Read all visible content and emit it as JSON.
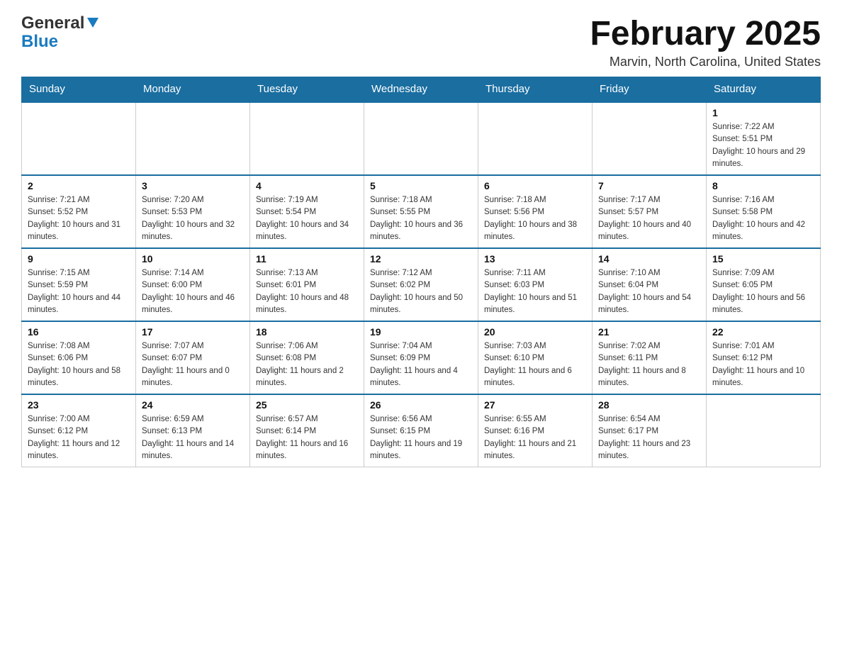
{
  "header": {
    "logo_general": "General",
    "logo_blue": "Blue",
    "title": "February 2025",
    "location": "Marvin, North Carolina, United States"
  },
  "days_of_week": [
    "Sunday",
    "Monday",
    "Tuesday",
    "Wednesday",
    "Thursday",
    "Friday",
    "Saturday"
  ],
  "weeks": [
    [
      {
        "day": "",
        "sunrise": "",
        "sunset": "",
        "daylight": ""
      },
      {
        "day": "",
        "sunrise": "",
        "sunset": "",
        "daylight": ""
      },
      {
        "day": "",
        "sunrise": "",
        "sunset": "",
        "daylight": ""
      },
      {
        "day": "",
        "sunrise": "",
        "sunset": "",
        "daylight": ""
      },
      {
        "day": "",
        "sunrise": "",
        "sunset": "",
        "daylight": ""
      },
      {
        "day": "",
        "sunrise": "",
        "sunset": "",
        "daylight": ""
      },
      {
        "day": "1",
        "sunrise": "Sunrise: 7:22 AM",
        "sunset": "Sunset: 5:51 PM",
        "daylight": "Daylight: 10 hours and 29 minutes."
      }
    ],
    [
      {
        "day": "2",
        "sunrise": "Sunrise: 7:21 AM",
        "sunset": "Sunset: 5:52 PM",
        "daylight": "Daylight: 10 hours and 31 minutes."
      },
      {
        "day": "3",
        "sunrise": "Sunrise: 7:20 AM",
        "sunset": "Sunset: 5:53 PM",
        "daylight": "Daylight: 10 hours and 32 minutes."
      },
      {
        "day": "4",
        "sunrise": "Sunrise: 7:19 AM",
        "sunset": "Sunset: 5:54 PM",
        "daylight": "Daylight: 10 hours and 34 minutes."
      },
      {
        "day": "5",
        "sunrise": "Sunrise: 7:18 AM",
        "sunset": "Sunset: 5:55 PM",
        "daylight": "Daylight: 10 hours and 36 minutes."
      },
      {
        "day": "6",
        "sunrise": "Sunrise: 7:18 AM",
        "sunset": "Sunset: 5:56 PM",
        "daylight": "Daylight: 10 hours and 38 minutes."
      },
      {
        "day": "7",
        "sunrise": "Sunrise: 7:17 AM",
        "sunset": "Sunset: 5:57 PM",
        "daylight": "Daylight: 10 hours and 40 minutes."
      },
      {
        "day": "8",
        "sunrise": "Sunrise: 7:16 AM",
        "sunset": "Sunset: 5:58 PM",
        "daylight": "Daylight: 10 hours and 42 minutes."
      }
    ],
    [
      {
        "day": "9",
        "sunrise": "Sunrise: 7:15 AM",
        "sunset": "Sunset: 5:59 PM",
        "daylight": "Daylight: 10 hours and 44 minutes."
      },
      {
        "day": "10",
        "sunrise": "Sunrise: 7:14 AM",
        "sunset": "Sunset: 6:00 PM",
        "daylight": "Daylight: 10 hours and 46 minutes."
      },
      {
        "day": "11",
        "sunrise": "Sunrise: 7:13 AM",
        "sunset": "Sunset: 6:01 PM",
        "daylight": "Daylight: 10 hours and 48 minutes."
      },
      {
        "day": "12",
        "sunrise": "Sunrise: 7:12 AM",
        "sunset": "Sunset: 6:02 PM",
        "daylight": "Daylight: 10 hours and 50 minutes."
      },
      {
        "day": "13",
        "sunrise": "Sunrise: 7:11 AM",
        "sunset": "Sunset: 6:03 PM",
        "daylight": "Daylight: 10 hours and 51 minutes."
      },
      {
        "day": "14",
        "sunrise": "Sunrise: 7:10 AM",
        "sunset": "Sunset: 6:04 PM",
        "daylight": "Daylight: 10 hours and 54 minutes."
      },
      {
        "day": "15",
        "sunrise": "Sunrise: 7:09 AM",
        "sunset": "Sunset: 6:05 PM",
        "daylight": "Daylight: 10 hours and 56 minutes."
      }
    ],
    [
      {
        "day": "16",
        "sunrise": "Sunrise: 7:08 AM",
        "sunset": "Sunset: 6:06 PM",
        "daylight": "Daylight: 10 hours and 58 minutes."
      },
      {
        "day": "17",
        "sunrise": "Sunrise: 7:07 AM",
        "sunset": "Sunset: 6:07 PM",
        "daylight": "Daylight: 11 hours and 0 minutes."
      },
      {
        "day": "18",
        "sunrise": "Sunrise: 7:06 AM",
        "sunset": "Sunset: 6:08 PM",
        "daylight": "Daylight: 11 hours and 2 minutes."
      },
      {
        "day": "19",
        "sunrise": "Sunrise: 7:04 AM",
        "sunset": "Sunset: 6:09 PM",
        "daylight": "Daylight: 11 hours and 4 minutes."
      },
      {
        "day": "20",
        "sunrise": "Sunrise: 7:03 AM",
        "sunset": "Sunset: 6:10 PM",
        "daylight": "Daylight: 11 hours and 6 minutes."
      },
      {
        "day": "21",
        "sunrise": "Sunrise: 7:02 AM",
        "sunset": "Sunset: 6:11 PM",
        "daylight": "Daylight: 11 hours and 8 minutes."
      },
      {
        "day": "22",
        "sunrise": "Sunrise: 7:01 AM",
        "sunset": "Sunset: 6:12 PM",
        "daylight": "Daylight: 11 hours and 10 minutes."
      }
    ],
    [
      {
        "day": "23",
        "sunrise": "Sunrise: 7:00 AM",
        "sunset": "Sunset: 6:12 PM",
        "daylight": "Daylight: 11 hours and 12 minutes."
      },
      {
        "day": "24",
        "sunrise": "Sunrise: 6:59 AM",
        "sunset": "Sunset: 6:13 PM",
        "daylight": "Daylight: 11 hours and 14 minutes."
      },
      {
        "day": "25",
        "sunrise": "Sunrise: 6:57 AM",
        "sunset": "Sunset: 6:14 PM",
        "daylight": "Daylight: 11 hours and 16 minutes."
      },
      {
        "day": "26",
        "sunrise": "Sunrise: 6:56 AM",
        "sunset": "Sunset: 6:15 PM",
        "daylight": "Daylight: 11 hours and 19 minutes."
      },
      {
        "day": "27",
        "sunrise": "Sunrise: 6:55 AM",
        "sunset": "Sunset: 6:16 PM",
        "daylight": "Daylight: 11 hours and 21 minutes."
      },
      {
        "day": "28",
        "sunrise": "Sunrise: 6:54 AM",
        "sunset": "Sunset: 6:17 PM",
        "daylight": "Daylight: 11 hours and 23 minutes."
      },
      {
        "day": "",
        "sunrise": "",
        "sunset": "",
        "daylight": ""
      }
    ]
  ]
}
